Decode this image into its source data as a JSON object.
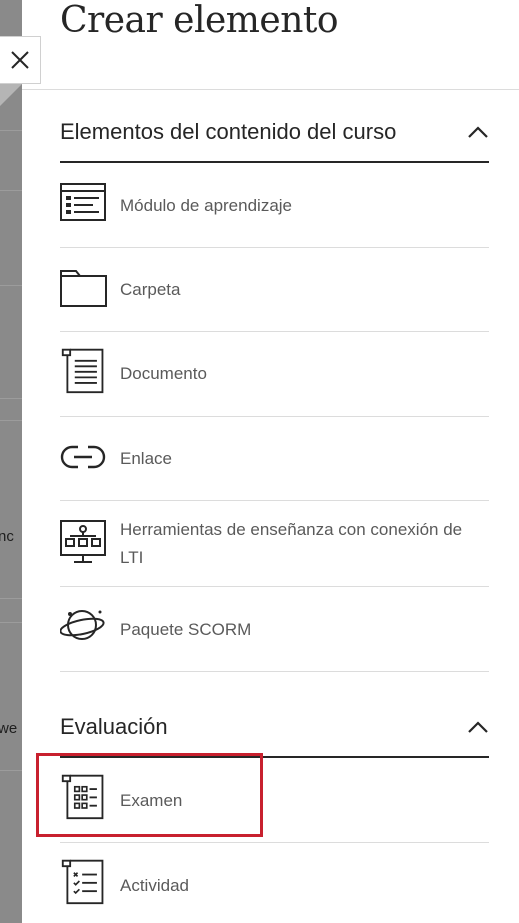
{
  "backdrop": {
    "fragment_1": "nc",
    "fragment_2": "we"
  },
  "close": {
    "label": "Cerrar",
    "icon": "close-icon"
  },
  "panel": {
    "title": "Crear elemento"
  },
  "sections": [
    {
      "label": "Elementos del contenido del curso",
      "expanded": true,
      "items": [
        {
          "label": "Módulo de aprendizaje",
          "icon": "learning-module-icon"
        },
        {
          "label": "Carpeta",
          "icon": "folder-icon"
        },
        {
          "label": "Documento",
          "icon": "document-icon"
        },
        {
          "label": "Enlace",
          "icon": "link-icon"
        },
        {
          "label": "Herramientas de enseñanza con conexión de LTI",
          "icon": "lti-tool-icon"
        },
        {
          "label": "Paquete SCORM",
          "icon": "scorm-package-icon"
        }
      ]
    },
    {
      "label": "Evaluación",
      "expanded": true,
      "items": [
        {
          "label": "Examen",
          "icon": "test-icon",
          "highlighted": true
        },
        {
          "label": "Actividad",
          "icon": "assignment-icon"
        }
      ]
    }
  ],
  "colors": {
    "highlight": "#c8202e",
    "backdrop": "#8a8a8a",
    "text": "#262626",
    "item_text": "#5a5a5a"
  }
}
